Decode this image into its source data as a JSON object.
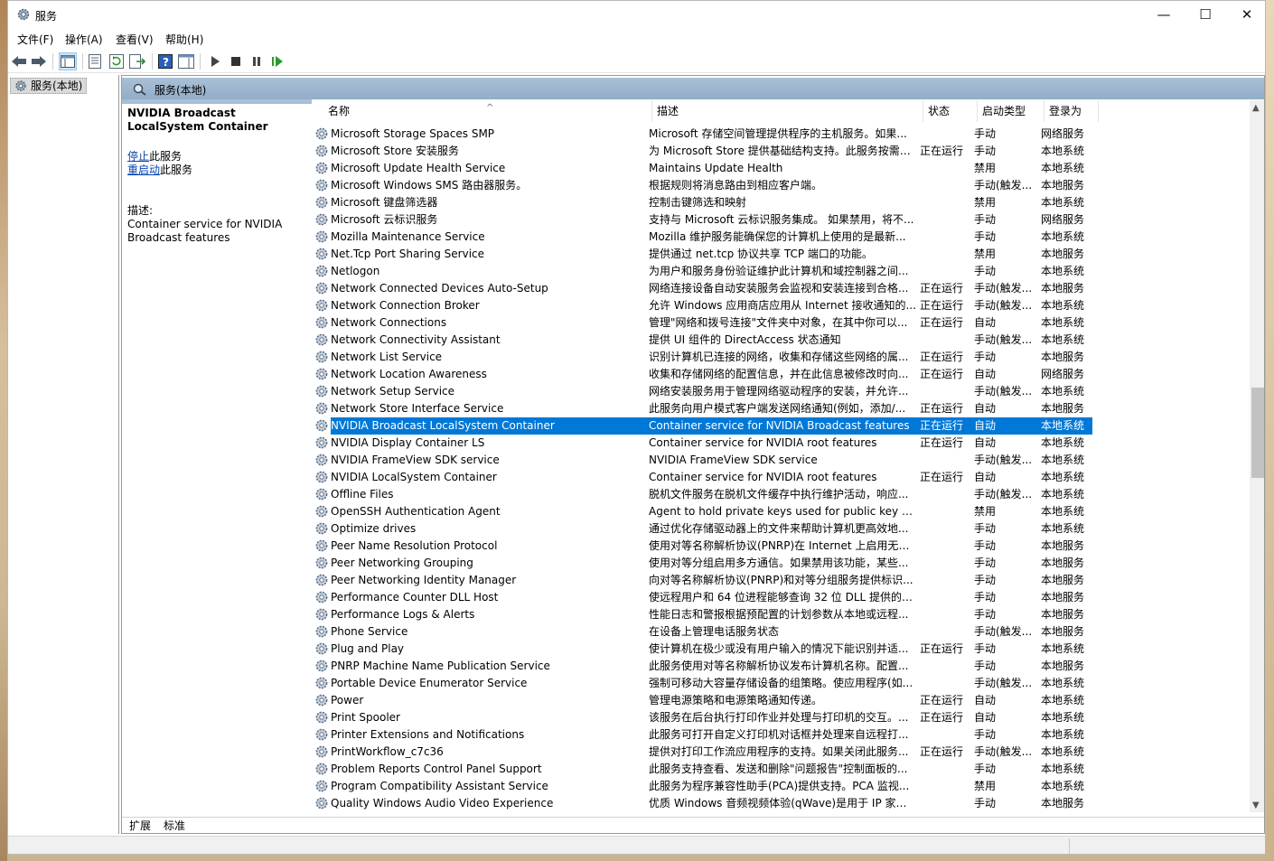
{
  "window": {
    "title": "服务",
    "minimize": "—",
    "maximize": "☐",
    "close": "✕"
  },
  "menu": [
    "文件(F)",
    "操作(A)",
    "查看(V)",
    "帮助(H)"
  ],
  "tree": {
    "root_label": "服务(本地)"
  },
  "content_header": "服务(本地)",
  "description": {
    "title": "NVIDIA Broadcast LocalSystem Container",
    "stop_link": "停止",
    "stop_suffix": "此服务",
    "restart_link": "重启动",
    "restart_suffix": "此服务",
    "label": "描述:",
    "text": "Container service for NVIDIA Broadcast features"
  },
  "columns": {
    "name": "名称",
    "desc": "描述",
    "status": "状态",
    "startup": "启动类型",
    "logon": "登录为"
  },
  "rows": [
    {
      "name": "Microsoft Storage Spaces SMP",
      "desc": "Microsoft 存储空间管理提供程序的主机服务。如果...",
      "status": "",
      "startup": "手动",
      "logon": "网络服务"
    },
    {
      "name": "Microsoft Store 安装服务",
      "desc": "为 Microsoft Store 提供基础结构支持。此服务按需启...",
      "status": "正在运行",
      "startup": "手动",
      "logon": "本地系统"
    },
    {
      "name": "Microsoft Update Health Service",
      "desc": "Maintains Update Health",
      "status": "",
      "startup": "禁用",
      "logon": "本地系统"
    },
    {
      "name": "Microsoft Windows SMS 路由器服务。",
      "desc": "根据规则将消息路由到相应客户端。",
      "status": "",
      "startup": "手动(触发...",
      "logon": "本地服务"
    },
    {
      "name": "Microsoft 键盘筛选器",
      "desc": "控制击键筛选和映射",
      "status": "",
      "startup": "禁用",
      "logon": "本地系统"
    },
    {
      "name": "Microsoft 云标识服务",
      "desc": "支持与 Microsoft 云标识服务集成。 如果禁用，将不...",
      "status": "",
      "startup": "手动",
      "logon": "网络服务"
    },
    {
      "name": "Mozilla Maintenance Service",
      "desc": "Mozilla 维护服务能确保您的计算机上使用的是最新...",
      "status": "",
      "startup": "手动",
      "logon": "本地系统"
    },
    {
      "name": "Net.Tcp Port Sharing Service",
      "desc": "提供通过 net.tcp 协议共享 TCP 端口的功能。",
      "status": "",
      "startup": "禁用",
      "logon": "本地服务"
    },
    {
      "name": "Netlogon",
      "desc": "为用户和服务身份验证维护此计算机和域控制器之间...",
      "status": "",
      "startup": "手动",
      "logon": "本地系统"
    },
    {
      "name": "Network Connected Devices Auto-Setup",
      "desc": "网络连接设备自动安装服务会监视和安装连接到合格...",
      "status": "正在运行",
      "startup": "手动(触发...",
      "logon": "本地服务"
    },
    {
      "name": "Network Connection Broker",
      "desc": "允许 Windows 应用商店应用从 Internet 接收通知的...",
      "status": "正在运行",
      "startup": "手动(触发...",
      "logon": "本地系统"
    },
    {
      "name": "Network Connections",
      "desc": "管理\"网络和拨号连接\"文件夹中对象，在其中你可以...",
      "status": "正在运行",
      "startup": "自动",
      "logon": "本地系统"
    },
    {
      "name": "Network Connectivity Assistant",
      "desc": "提供 UI 组件的 DirectAccess 状态通知",
      "status": "",
      "startup": "手动(触发...",
      "logon": "本地系统"
    },
    {
      "name": "Network List Service",
      "desc": "识别计算机已连接的网络，收集和存储这些网络的属...",
      "status": "正在运行",
      "startup": "手动",
      "logon": "本地服务"
    },
    {
      "name": "Network Location Awareness",
      "desc": "收集和存储网络的配置信息，并在此信息被修改时向...",
      "status": "正在运行",
      "startup": "自动",
      "logon": "网络服务"
    },
    {
      "name": "Network Setup Service",
      "desc": "网络安装服务用于管理网络驱动程序的安装，并允许...",
      "status": "",
      "startup": "手动(触发...",
      "logon": "本地系统"
    },
    {
      "name": "Network Store Interface Service",
      "desc": "此服务向用户模式客户端发送网络通知(例如，添加/...",
      "status": "正在运行",
      "startup": "自动",
      "logon": "本地服务"
    },
    {
      "name": "NVIDIA Broadcast LocalSystem Container",
      "desc": "Container service for NVIDIA Broadcast features",
      "status": "正在运行",
      "startup": "自动",
      "logon": "本地系统",
      "selected": true
    },
    {
      "name": "NVIDIA Display Container LS",
      "desc": "Container service for NVIDIA root features",
      "status": "正在运行",
      "startup": "自动",
      "logon": "本地系统"
    },
    {
      "name": "NVIDIA FrameView SDK service",
      "desc": "NVIDIA FrameView SDK service",
      "status": "",
      "startup": "手动(触发...",
      "logon": "本地系统"
    },
    {
      "name": "NVIDIA LocalSystem Container",
      "desc": "Container service for NVIDIA root features",
      "status": "正在运行",
      "startup": "自动",
      "logon": "本地系统"
    },
    {
      "name": "Offline Files",
      "desc": "脱机文件服务在脱机文件缓存中执行维护活动，响应...",
      "status": "",
      "startup": "手动(触发...",
      "logon": "本地系统"
    },
    {
      "name": "OpenSSH Authentication Agent",
      "desc": "Agent to hold private keys used for public key authe...",
      "status": "",
      "startup": "禁用",
      "logon": "本地系统"
    },
    {
      "name": "Optimize drives",
      "desc": "通过优化存储驱动器上的文件来帮助计算机更高效地...",
      "status": "",
      "startup": "手动",
      "logon": "本地系统"
    },
    {
      "name": "Peer Name Resolution Protocol",
      "desc": "使用对等名称解析协议(PNRP)在 Internet 上启用无服...",
      "status": "",
      "startup": "手动",
      "logon": "本地服务"
    },
    {
      "name": "Peer Networking Grouping",
      "desc": "使用对等分组启用多方通信。如果禁用该功能，某些...",
      "status": "",
      "startup": "手动",
      "logon": "本地服务"
    },
    {
      "name": "Peer Networking Identity Manager",
      "desc": "向对等名称解析协议(PNRP)和对等分组服务提供标识...",
      "status": "",
      "startup": "手动",
      "logon": "本地服务"
    },
    {
      "name": "Performance Counter DLL Host",
      "desc": "使远程用户和 64 位进程能够查询 32 位 DLL 提供的性...",
      "status": "",
      "startup": "手动",
      "logon": "本地服务"
    },
    {
      "name": "Performance Logs & Alerts",
      "desc": "性能日志和警报根据预配置的计划参数从本地或远程...",
      "status": "",
      "startup": "手动",
      "logon": "本地服务"
    },
    {
      "name": "Phone Service",
      "desc": "在设备上管理电话服务状态",
      "status": "",
      "startup": "手动(触发...",
      "logon": "本地服务"
    },
    {
      "name": "Plug and Play",
      "desc": "使计算机在极少或没有用户输入的情况下能识别并适...",
      "status": "正在运行",
      "startup": "手动",
      "logon": "本地系统"
    },
    {
      "name": "PNRP Machine Name Publication Service",
      "desc": "此服务使用对等名称解析协议发布计算机名称。配置...",
      "status": "",
      "startup": "手动",
      "logon": "本地服务"
    },
    {
      "name": "Portable Device Enumerator Service",
      "desc": "强制可移动大容量存储设备的组策略。使应用程序(如...",
      "status": "",
      "startup": "手动(触发...",
      "logon": "本地系统"
    },
    {
      "name": "Power",
      "desc": "管理电源策略和电源策略通知传递。",
      "status": "正在运行",
      "startup": "自动",
      "logon": "本地系统"
    },
    {
      "name": "Print Spooler",
      "desc": "该服务在后台执行打印作业并处理与打印机的交互。...",
      "status": "正在运行",
      "startup": "自动",
      "logon": "本地系统"
    },
    {
      "name": "Printer Extensions and Notifications",
      "desc": "此服务可打开自定义打印机对话框并处理来自远程打...",
      "status": "",
      "startup": "手动",
      "logon": "本地系统"
    },
    {
      "name": "PrintWorkflow_c7c36",
      "desc": "提供对打印工作流应用程序的支持。如果关闭此服务...",
      "status": "正在运行",
      "startup": "手动(触发...",
      "logon": "本地系统"
    },
    {
      "name": "Problem Reports Control Panel Support",
      "desc": "此服务支持查看、发送和删除\"问题报告\"控制面板的...",
      "status": "",
      "startup": "手动",
      "logon": "本地系统"
    },
    {
      "name": "Program Compatibility Assistant Service",
      "desc": "此服务为程序兼容性助手(PCA)提供支持。PCA 监视...",
      "status": "",
      "startup": "禁用",
      "logon": "本地系统"
    },
    {
      "name": "Quality Windows Audio Video Experience",
      "desc": "优质 Windows 音频视频体验(qWave)是用于 IP 家庭...",
      "status": "",
      "startup": "手动",
      "logon": "本地服务"
    }
  ],
  "tabs": [
    "扩展",
    "标准"
  ]
}
